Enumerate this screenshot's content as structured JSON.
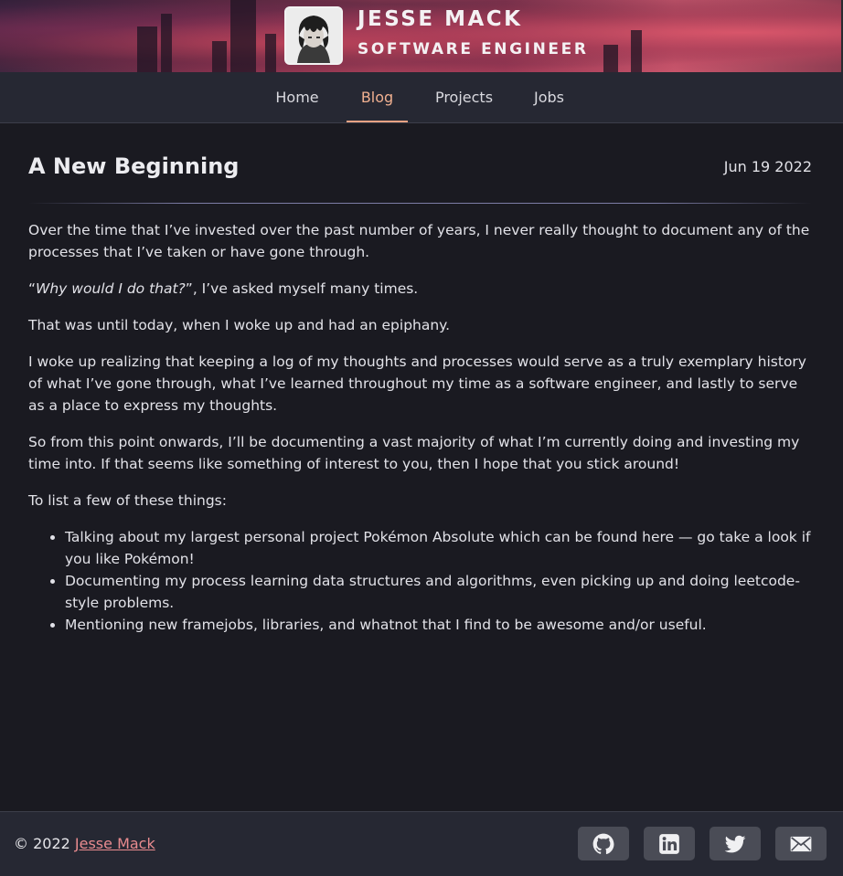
{
  "header": {
    "name": "JESSE MACK",
    "title": "SOFTWARE ENGINEER",
    "avatar_icon": "avatar-portrait"
  },
  "nav": {
    "items": [
      {
        "label": "Home",
        "active": false
      },
      {
        "label": "Blog",
        "active": true
      },
      {
        "label": "Projects",
        "active": false
      },
      {
        "label": "Jobs",
        "active": false
      }
    ]
  },
  "post": {
    "title": "A New Beginning",
    "date": "Jun 19 2022",
    "paragraphs": [
      "Over the time that I’ve invested over the past number of years, I never really thought to document any of the processes that I’ve taken or have gone through.",
      "That was until today, when I woke up and had an epiphany.",
      "I woke up realizing that keeping a log of my thoughts and processes would serve as a truly exemplary history of what I’ve gone through, what I’ve learned throughout my time as a software engineer, and lastly to serve as a place to express my thoughts.",
      "So from this point onwards, I’ll be documenting a vast majority of what I’m currently doing and investing my time into. If that seems like something of interest to you, then I hope that you stick around!",
      "To list a few of these things:"
    ],
    "quote_open": "“",
    "quote_text": "Why would I do that?",
    "quote_rest": "”, I’ve asked myself many times.",
    "list": [
      "Talking about my largest personal project Pokémon Absolute which can be found here — go take a look if you like Pokémon!",
      "Documenting my process learning data structures and algorithms, even picking up and doing leetcode-style problems.",
      "Mentioning new framejobs, libraries, and whatnot that I find to be awesome and/or useful."
    ]
  },
  "footer": {
    "copyright": "© 2022",
    "author_link": "Jesse Mack",
    "social": [
      {
        "icon": "github-icon"
      },
      {
        "icon": "linkedin-icon"
      },
      {
        "icon": "twitter-icon"
      },
      {
        "icon": "mail-icon"
      }
    ]
  },
  "colors": {
    "background": "#1a1a21",
    "nav_background": "#262833",
    "accent": "#e8a283",
    "link": "#e98b8f"
  }
}
